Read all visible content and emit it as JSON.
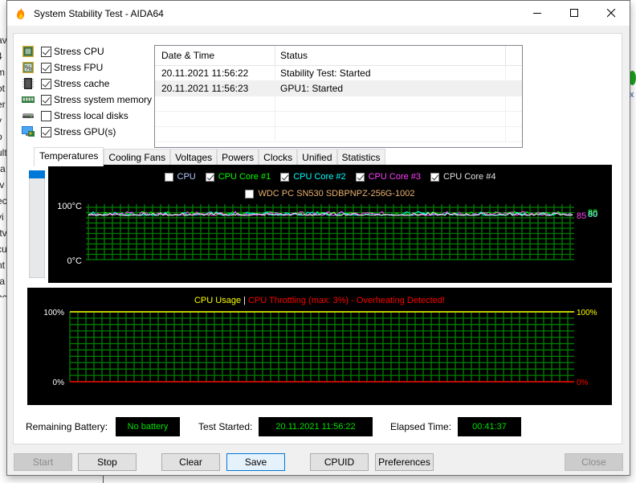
{
  "window": {
    "title": "System Stability Test - AIDA64",
    "minimize_label": "Minimize",
    "maximize_label": "Maximize",
    "close_label": "Close window"
  },
  "background_app": {
    "left_fragments": [
      "av",
      "4",
      "m",
      "ot",
      "er",
      "v",
      "p",
      "ult",
      "ra",
      "tv",
      "ec",
      "vi",
      "ftv",
      "cu",
      "nt",
      "ta",
      "nc"
    ]
  },
  "stress_options": [
    {
      "label": "Stress CPU",
      "checked": true,
      "icon": "cpu-chip-icon"
    },
    {
      "label": "Stress FPU",
      "checked": true,
      "icon": "fpu-percent-icon"
    },
    {
      "label": "Stress cache",
      "checked": true,
      "icon": "cache-chip-icon"
    },
    {
      "label": "Stress system memory",
      "checked": true,
      "icon": "memory-module-icon"
    },
    {
      "label": "Stress local disks",
      "checked": false,
      "icon": "disk-drive-icon"
    },
    {
      "label": "Stress GPU(s)",
      "checked": true,
      "icon": "gpu-monitor-icon"
    }
  ],
  "log": {
    "columns": [
      "Date & Time",
      "Status"
    ],
    "rows": [
      {
        "datetime": "20.11.2021 11:56:22",
        "status": "Stability Test: Started"
      },
      {
        "datetime": "20.11.2021 11:56:23",
        "status": "GPU1: Started"
      }
    ]
  },
  "tabs": [
    {
      "label": "Temperatures",
      "active": true
    },
    {
      "label": "Cooling Fans",
      "active": false
    },
    {
      "label": "Voltages",
      "active": false
    },
    {
      "label": "Powers",
      "active": false
    },
    {
      "label": "Clocks",
      "active": false
    },
    {
      "label": "Unified",
      "active": false
    },
    {
      "label": "Statistics",
      "active": false
    }
  ],
  "colors": {
    "cpu": "#b4c8ff",
    "core1": "#00ff00",
    "core2": "#00ffff",
    "core3": "#ff40ff",
    "core4": "#e0e0e0",
    "disk": "#e8b070",
    "grid": "#008000",
    "usage": "#ffff00",
    "throttle": "#ff0000",
    "status_text": "#00e000"
  },
  "chart_data": [
    {
      "type": "line",
      "title": "Temperatures",
      "ylabel": "",
      "yticks": [
        "100°C",
        "0°C"
      ],
      "ylim": [
        0,
        100
      ],
      "grid": true,
      "legend": [
        {
          "name": "CPU",
          "checked": false,
          "color": "#b4c8ff"
        },
        {
          "name": "CPU Core #1",
          "checked": true,
          "color": "#00ff00"
        },
        {
          "name": "CPU Core #2",
          "checked": true,
          "color": "#00ffff"
        },
        {
          "name": "CPU Core #3",
          "checked": true,
          "color": "#ff40ff"
        },
        {
          "name": "CPU Core #4",
          "checked": true,
          "color": "#e0e0e0"
        },
        {
          "name": "WDC PC SN530 SDBPNPZ-256G-1002",
          "checked": false,
          "color": "#e8b070"
        }
      ],
      "series": [
        {
          "name": "CPU Core #1",
          "current": 88,
          "approx_range": [
            84,
            92
          ]
        },
        {
          "name": "CPU Core #2",
          "current": 80,
          "approx_range": [
            83,
            92
          ]
        },
        {
          "name": "CPU Core #3",
          "current": 85,
          "approx_range": [
            83,
            92
          ]
        },
        {
          "name": "CPU Core #4",
          "current": 80,
          "approx_range": [
            83,
            90
          ]
        }
      ],
      "value_labels": [
        {
          "text": "85",
          "color": "#ff40ff"
        },
        {
          "text": "88",
          "color": "#00ff00"
        },
        {
          "text": "80",
          "color": "#00ffff"
        },
        {
          "text": "80",
          "color": "#e0e0e0"
        }
      ]
    },
    {
      "type": "line",
      "title_parts": [
        {
          "text": "CPU Usage",
          "color": "#ffff00"
        },
        {
          "text": " | ",
          "color": "#ffffff"
        },
        {
          "text": "CPU Throttling (max: 3%) - Overheating Detected!",
          "color": "#ff0000"
        }
      ],
      "yticks_left": [
        "100%",
        "0%"
      ],
      "yticks_right": [
        {
          "text": "100%",
          "color": "#ffff00"
        },
        {
          "text": "0%",
          "color": "#ff0000"
        }
      ],
      "ylim": [
        0,
        100
      ],
      "grid": true,
      "series": [
        {
          "name": "CPU Usage",
          "value": 100,
          "color": "#ffff00"
        },
        {
          "name": "CPU Throttling",
          "value": 0,
          "color": "#ff0000"
        }
      ]
    }
  ],
  "status": {
    "battery_label": "Remaining Battery:",
    "battery_value": "No battery",
    "started_label": "Test Started:",
    "started_value": "20.11.2021 11:56:22",
    "elapsed_label": "Elapsed Time:",
    "elapsed_value": "00:41:37"
  },
  "buttons": {
    "start": "Start",
    "stop": "Stop",
    "clear": "Clear",
    "save": "Save",
    "cpuid": "CPUID",
    "preferences": "Preferences",
    "close": "Close"
  }
}
